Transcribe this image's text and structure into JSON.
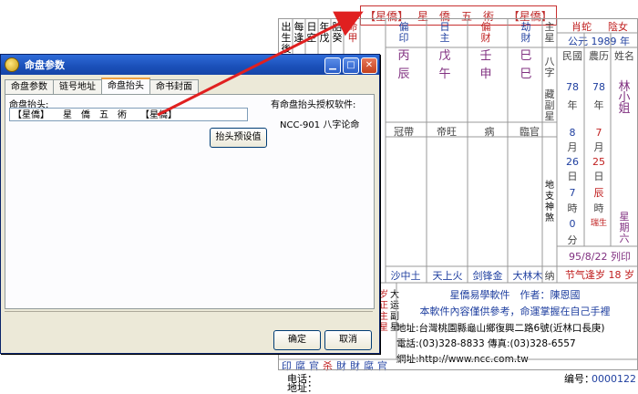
{
  "chart": {
    "title": "【星僑】　 星　僑　五　術　 【星僑】",
    "zodiac": "肖蛇",
    "gender": "陰女",
    "gregorian": "公元 1989 年",
    "labels_left": [
      "出生後",
      "每逢",
      "日空",
      "年戊",
      "胎癸",
      "命甲"
    ],
    "labels_right_header": [
      "民國",
      "農历",
      "姓名"
    ],
    "name": "林小姐",
    "roc_year": "78",
    "lunar_year": "78",
    "year_unit": "年",
    "month_vals": [
      "8",
      "7"
    ],
    "month_unit": "月",
    "day_vals": [
      "26",
      "25"
    ],
    "day_unit": "日",
    "hour_vals": [
      "7",
      "辰"
    ],
    "hour_unit": "時",
    "min_vals": [
      "0",
      "瑞生"
    ],
    "min_unit": "分",
    "star_label": "星期六",
    "print_date": "95/8/22 列印",
    "festival": "节气逢岁 18 岁",
    "eight_chars": "八字",
    "hidden_stem": "藏副星",
    "ten_gods_top": [
      "偏印",
      "日主",
      "偏财",
      "劫財"
    ],
    "stems": [
      "丙",
      "戊",
      "壬",
      "巳"
    ],
    "branches": [
      "辰",
      "午",
      "申",
      "巳"
    ],
    "star_col": "主星",
    "lifestage": [
      "冠帶",
      "帝旺",
      "病",
      "臨官"
    ],
    "nayin": [
      "沙中土",
      "天上火",
      "剑锋金",
      "大林木"
    ],
    "nayin_end": "纳",
    "footer_company": "星僑易學軟件　作者：陳恩國",
    "footer_note": "本軟件內容僅供參考，命運掌握在自己手裡",
    "footer_address": "地址:台灣桃園縣龜山鄉復興二路6號(近林口長庚)",
    "footer_tel": "電話:(03)328-8833 傳真:(03)328-6557",
    "footer_web": "網址:http://www.ncc.com.tw",
    "bottom_row": [
      "印",
      "腐",
      "官",
      "杀",
      "財",
      "財",
      "腐",
      "官"
    ],
    "phone_label": "电话：",
    "address_label": "地址：",
    "serial_label": "编号：",
    "serial_value": "0000122",
    "side_texts": [
      "地支神煞",
      "岁正主星",
      "大运副星"
    ]
  },
  "dialog": {
    "title": "命盘参数",
    "tabs": [
      "命盘参数",
      "链号地址",
      "命盘抬头",
      "命书封面"
    ],
    "active_tab": 2,
    "field_label": "命盘抬头:",
    "field_value": "【星僑】　　星　僑　五　術　　【星僑】",
    "preview_button": "抬头预设值",
    "auth_label": "有命盘抬头授权软件:",
    "auth_software": "NCC-901 八字论命",
    "ok_button": "确定",
    "cancel_button": "取消"
  },
  "colors": {
    "titlebar": "#1a4fb8",
    "arrow": "#e02020",
    "accent_red": "#c02020",
    "accent_blue": "#2040a0"
  }
}
